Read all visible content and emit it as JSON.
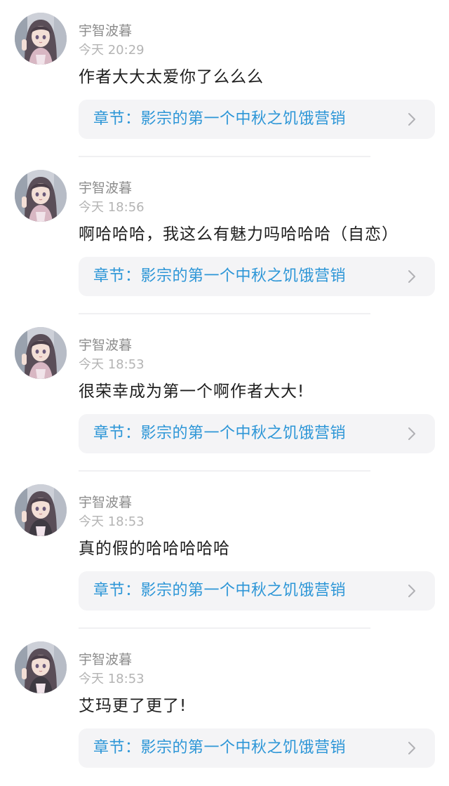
{
  "comments": [
    {
      "username": "宇智波暮",
      "time": "今天 20:29",
      "text": "作者大大太爱你了么么么",
      "chapter": "章节：影宗的第一个中秋之饥饿营销"
    },
    {
      "username": "宇智波暮",
      "time": "今天 18:56",
      "text": "啊哈哈哈，我这么有魅力吗哈哈哈（自恋）",
      "chapter": "章节：影宗的第一个中秋之饥饿营销"
    },
    {
      "username": "宇智波暮",
      "time": "今天 18:53",
      "text": "很荣幸成为第一个啊作者大大!",
      "chapter": "章节：影宗的第一个中秋之饥饿营销"
    },
    {
      "username": "宇智波暮",
      "time": "今天 18:53",
      "text": "真的假的哈哈哈哈哈",
      "chapter": "章节：影宗的第一个中秋之饥饿营销"
    },
    {
      "username": "宇智波暮",
      "time": "今天 18:53",
      "text": "艾玛更了更了!",
      "chapter": "章节：影宗的第一个中秋之饥饿营销"
    }
  ],
  "icons": {
    "avatar": "anime-girl-avatar",
    "chevron": "chevron-right-icon"
  },
  "colors": {
    "chapter_link": "#2d96d7",
    "card_background": "#f4f4f6",
    "username": "#8c8c8c",
    "timestamp": "#b4b4b4",
    "body_text": "#1e1e1e"
  }
}
